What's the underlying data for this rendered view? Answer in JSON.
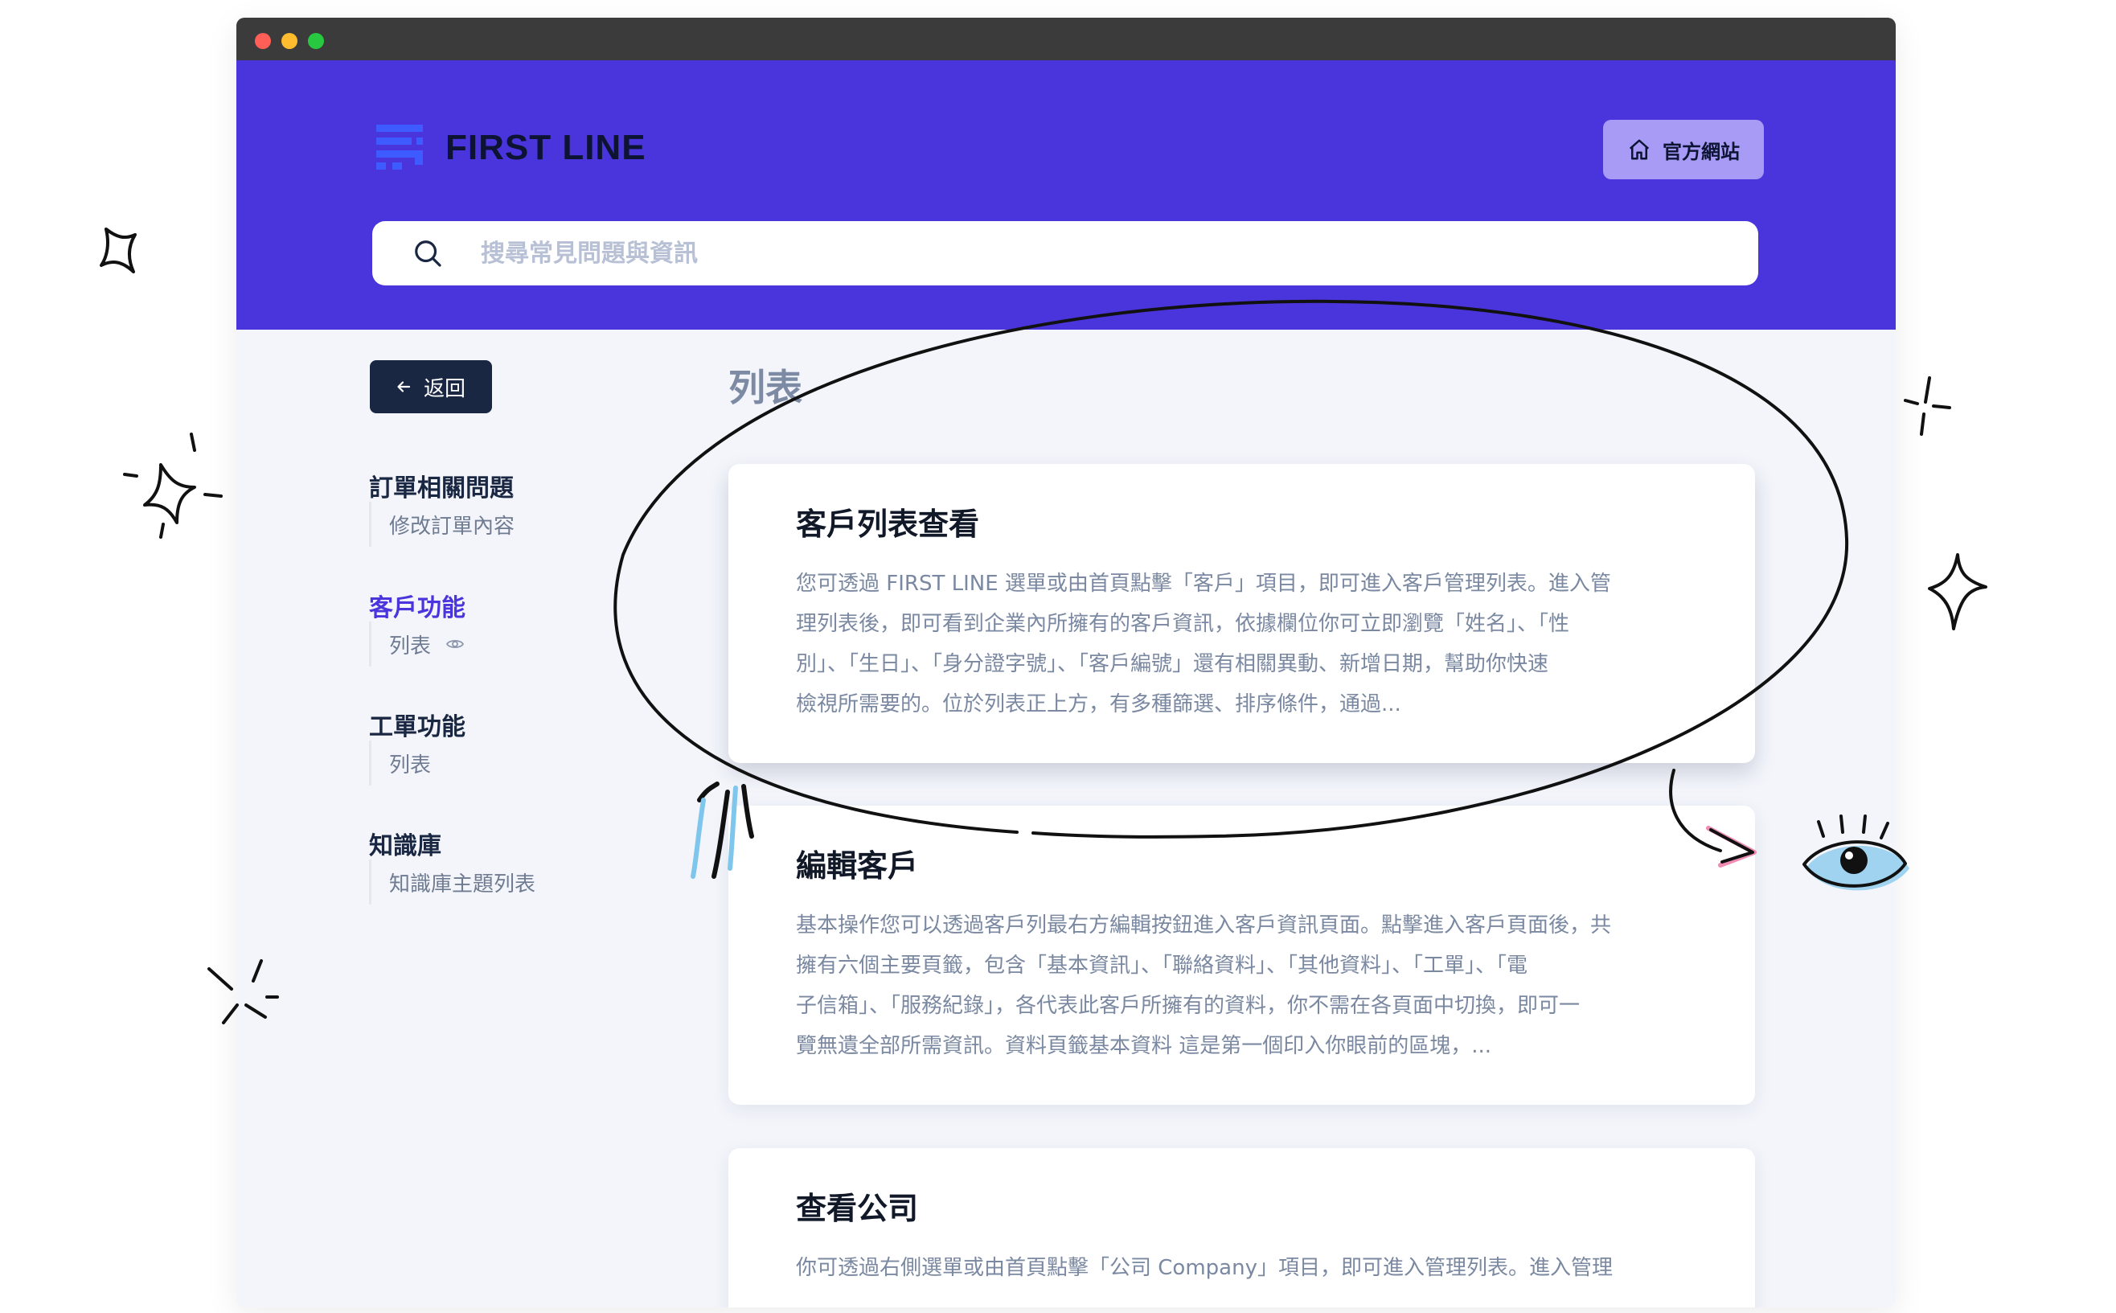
{
  "window": {
    "controls": [
      "close",
      "minimize",
      "maximize"
    ]
  },
  "header": {
    "brand": "FIRST LINE",
    "site_button": "官方網站",
    "search_placeholder": "搜尋常見問題與資訊"
  },
  "sidebar": {
    "back_label": "返回",
    "groups": [
      {
        "title": "訂單相關問題",
        "items": [
          "修改訂單內容"
        ]
      },
      {
        "title": "客戶功能",
        "items": [
          "列表"
        ],
        "active": true
      },
      {
        "title": "工單功能",
        "items": [
          "列表"
        ]
      },
      {
        "title": "知識庫",
        "items": [
          "知識庫主題列表"
        ]
      }
    ]
  },
  "main": {
    "title": "列表",
    "cards": [
      {
        "title": "客戶列表查看",
        "lines": [
          "您可透過 FIRST LINE 選單或由首頁點擊「客戶」項目，即可進入客戶管理列表。進入管",
          "理列表後，即可看到企業內所擁有的客戶資訊，依據欄位你可立即瀏覽「姓名」、「性",
          "別」、「生日」、「身分證字號」、「客戶編號」還有相關異動、新增日期，幫助你快速",
          "檢視所需要的。位於列表正上方，有多種篩選、排序條件，通過..."
        ]
      },
      {
        "title": "編輯客戶",
        "lines": [
          "基本操作您可以透過客戶列最右方編輯按鈕進入客戶資訊頁面。點擊進入客戶頁面後，共",
          "擁有六個主要頁籤，包含「基本資訊」、「聯絡資料」、「其他資料」、「工單」、「電",
          "子信箱」、「服務紀錄」，各代表此客戶所擁有的資料，你不需在各頁面中切換，即可一",
          "覽無遺全部所需資訊。資料頁籤基本資料 這是第一個印入你眼前的區塊，..."
        ]
      },
      {
        "title": "查看公司",
        "lines": [
          "你可透過右側選單或由首頁點擊「公司 Company」項目，即可進入管理列表。進入管理"
        ]
      }
    ]
  },
  "colors": {
    "header_bg": "#4a35dc",
    "accent": "#4a35dc",
    "site_button_bg": "#a79bf5",
    "back_button_bg": "#1a2742"
  },
  "icons": [
    "logo-icon",
    "home-icon",
    "search-icon",
    "arrow-left-icon",
    "eye-icon"
  ]
}
